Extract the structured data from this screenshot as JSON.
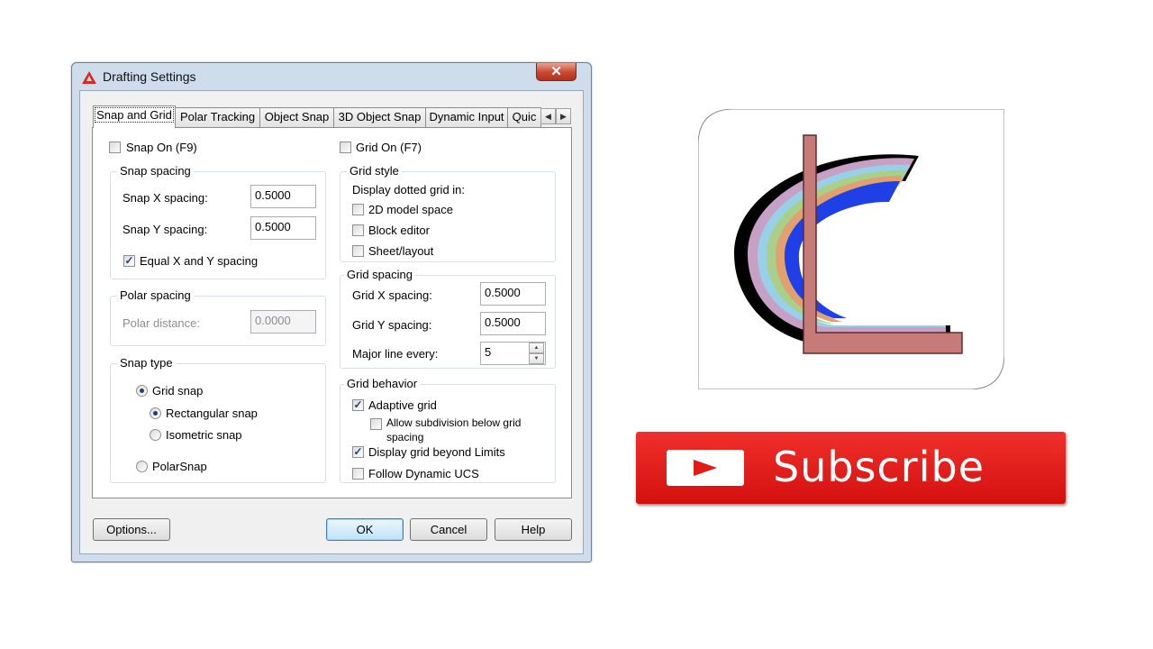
{
  "dialog": {
    "title": "Drafting Settings",
    "close_glyph": "✕",
    "tabs": [
      "Snap and Grid",
      "Polar Tracking",
      "Object Snap",
      "3D Object Snap",
      "Dynamic Input",
      "Quic"
    ],
    "tab_scroll_left": "◀",
    "tab_scroll_right": "▶",
    "snap_on_label": "Snap On (F9)",
    "grid_on_label": "Grid On (F7)",
    "snap_spacing": {
      "legend": "Snap spacing",
      "x_label": "Snap X spacing:",
      "x_value": "0.5000",
      "y_label": "Snap Y spacing:",
      "y_value": "0.5000",
      "equal_label": "Equal X and Y spacing",
      "equal_checked": true
    },
    "polar_spacing": {
      "legend": "Polar spacing",
      "distance_label": "Polar distance:",
      "distance_value": "0.0000"
    },
    "snap_type": {
      "legend": "Snap type",
      "grid_snap": "Grid snap",
      "rectangular_snap": "Rectangular snap",
      "isometric_snap": "Isometric snap",
      "polar_snap": "PolarSnap",
      "selected": "rectangular"
    },
    "grid_style": {
      "legend": "Grid style",
      "caption": "Display dotted grid in:",
      "model_space": "2D model space",
      "block_editor": "Block editor",
      "sheet_layout": "Sheet/layout"
    },
    "grid_spacing": {
      "legend": "Grid spacing",
      "x_label": "Grid X spacing:",
      "x_value": "0.5000",
      "y_label": "Grid Y spacing:",
      "y_value": "0.5000",
      "major_label": "Major line every:",
      "major_value": "5"
    },
    "grid_behavior": {
      "legend": "Grid behavior",
      "adaptive": "Adaptive grid",
      "adaptive_checked": true,
      "subdivision_line1": "Allow subdivision below grid",
      "subdivision_line2": "spacing",
      "subdivision_checked": false,
      "beyond_limits": "Display grid beyond Limits",
      "beyond_limits_checked": true,
      "dynamic_ucs": "Follow Dynamic UCS",
      "dynamic_ucs_checked": false
    },
    "buttons": {
      "options": "Options...",
      "ok": "OK",
      "cancel": "Cancel",
      "help": "Help"
    },
    "check_glyph": "✓",
    "colors": {
      "title_bar": "#cfdcec",
      "close_button": "#c8472f",
      "app_icon": "#d42a20"
    }
  },
  "logo": {
    "icon_name": "cl-logo-icon",
    "arc_colors": [
      "#000000",
      "#c7a0c6",
      "#98d0e8",
      "#a8d08a",
      "#e0a070",
      "#1e40e6"
    ],
    "bar_color": "#c67b78"
  },
  "subscribe": {
    "label": "Subscribe",
    "icon_name": "play-icon",
    "color": "#e31b16"
  }
}
